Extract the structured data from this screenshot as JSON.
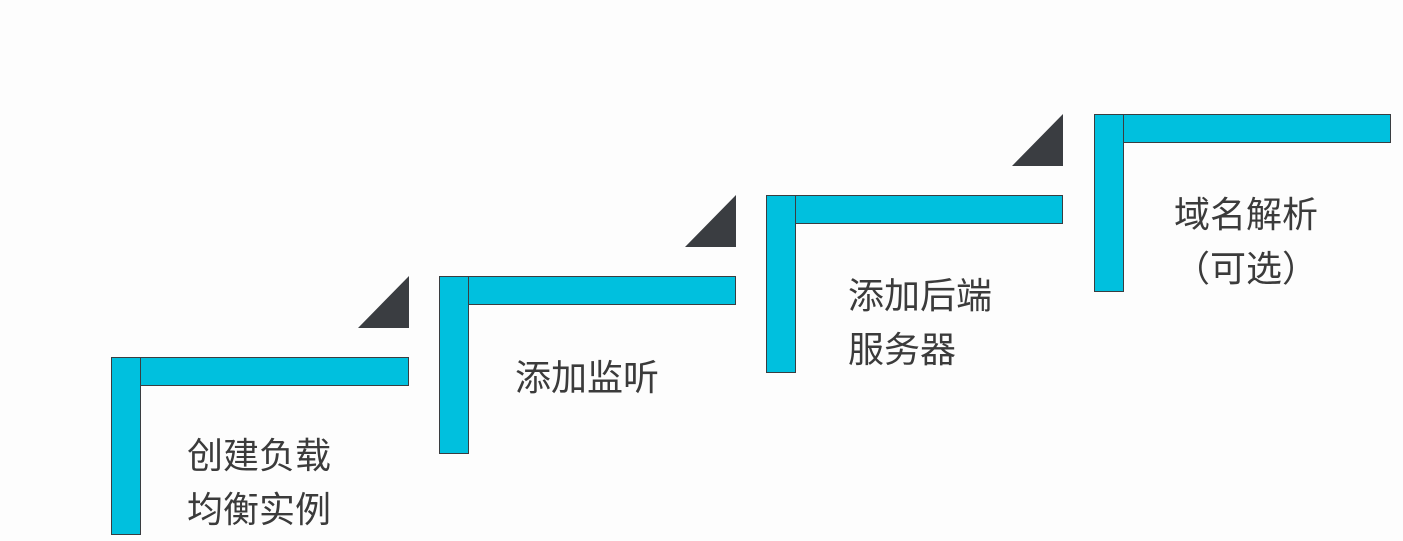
{
  "theme": {
    "step_color": "#00c0de",
    "corner_color": "#3a3d41",
    "text_color": "#3b3b3b"
  },
  "steps": [
    {
      "lines": [
        "创建负载",
        "均衡实例"
      ]
    },
    {
      "lines": [
        "添加监听"
      ]
    },
    {
      "lines": [
        "添加后端",
        "服务器"
      ]
    },
    {
      "lines": [
        "域名解析",
        "（可选）"
      ]
    }
  ]
}
